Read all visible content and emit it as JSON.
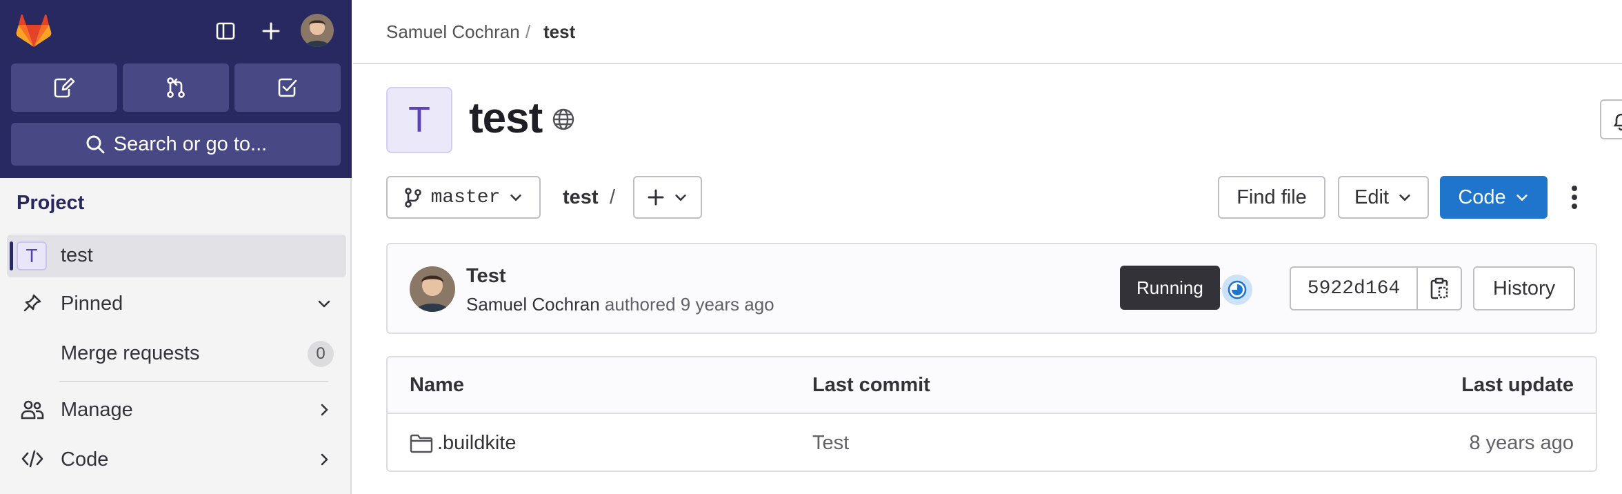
{
  "sidebar": {
    "section_title": "Project",
    "project_initial": "T",
    "project_name": "test",
    "items": [
      {
        "label": "Pinned"
      },
      {
        "label": "Merge requests",
        "count": "0"
      },
      {
        "label": "Manage"
      },
      {
        "label": "Code"
      }
    ],
    "search_label": "Search or go to..."
  },
  "breadcrumb": {
    "owner": "Samuel Cochran",
    "separator": "/",
    "project": "test"
  },
  "project": {
    "initial": "T",
    "title": "test"
  },
  "toolbar": {
    "branch": "master",
    "path": "test",
    "path_separator": "/",
    "find_file": "Find file",
    "edit": "Edit",
    "code": "Code"
  },
  "commit": {
    "title": "Test",
    "author": "Samuel Cochran",
    "meta_suffix": "authored 9 years ago",
    "tooltip": "Running",
    "sha": "5922d164",
    "history": "History"
  },
  "table": {
    "headers": {
      "name": "Name",
      "last_commit": "Last commit",
      "last_update": "Last update"
    },
    "rows": [
      {
        "name": ".buildkite",
        "last_commit": "Test",
        "last_update": "8 years ago"
      }
    ]
  },
  "colors": {
    "sidebar_dark": "#292961",
    "tile": "#484884",
    "primary": "#1f75cb",
    "tanuki_orange": "#fc6d26"
  }
}
